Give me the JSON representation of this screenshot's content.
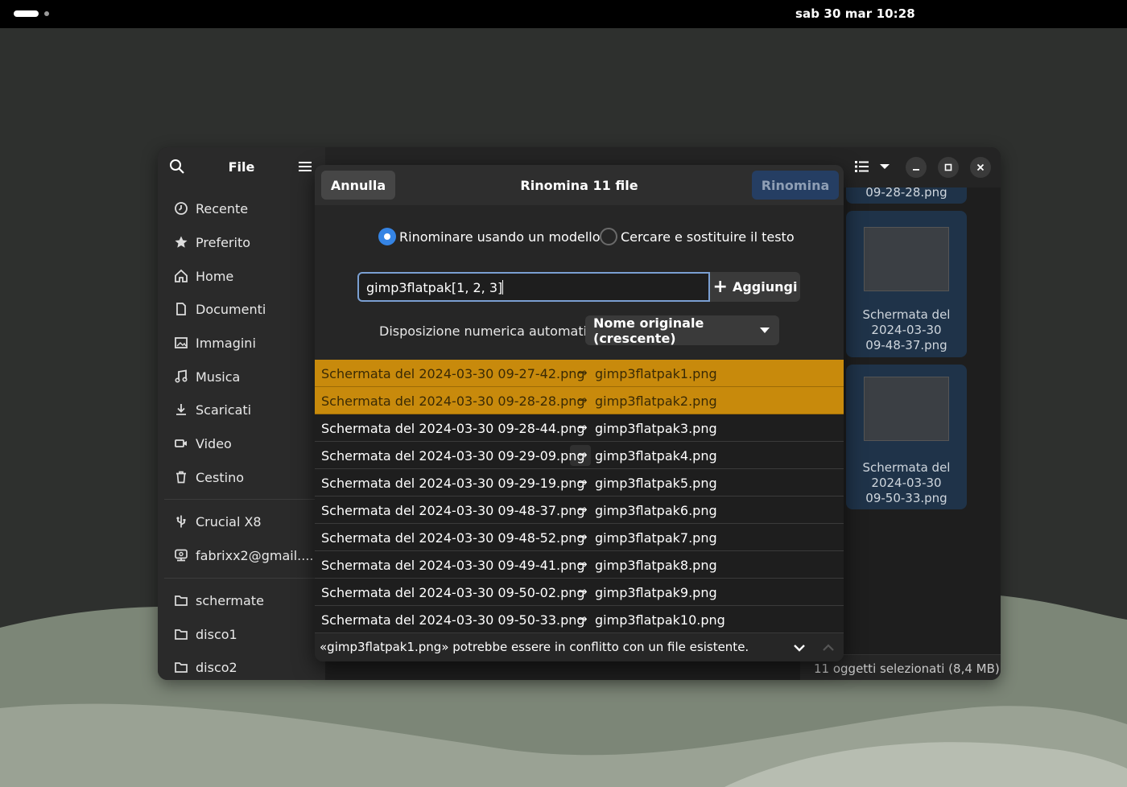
{
  "topbar": {
    "clock": "sab 30 mar  10:28"
  },
  "sidebar": {
    "title": "File",
    "places": [
      {
        "label": "Recente",
        "icon": "clock-icon"
      },
      {
        "label": "Preferito",
        "icon": "star-icon"
      },
      {
        "label": "Home",
        "icon": "home-icon"
      },
      {
        "label": "Documenti",
        "icon": "document-icon"
      },
      {
        "label": "Immagini",
        "icon": "image-icon"
      },
      {
        "label": "Musica",
        "icon": "music-icon"
      },
      {
        "label": "Scaricati",
        "icon": "download-icon"
      },
      {
        "label": "Video",
        "icon": "video-icon"
      },
      {
        "label": "Cestino",
        "icon": "trash-icon"
      }
    ],
    "devices": [
      {
        "label": "Crucial X8",
        "icon": "usb-icon"
      },
      {
        "label": "fabrixx2@gmail....",
        "icon": "network-icon"
      }
    ],
    "bookmarks": [
      {
        "label": "schermate",
        "icon": "folder-icon"
      },
      {
        "label": "disco1",
        "icon": "folder-icon"
      },
      {
        "label": "disco2",
        "icon": "folder-icon"
      }
    ]
  },
  "content": {
    "tiles": [
      {
        "caption": [
          "09-28-28.png"
        ]
      },
      {
        "caption": [
          "Schermata del",
          "2024-03-30",
          "09-48-37.png"
        ]
      },
      {
        "caption": [
          "Schermata del",
          "2024-03-30",
          "09-50-33.png"
        ]
      }
    ],
    "status": "11 oggetti selezionati  (8,4 MB)"
  },
  "dialog": {
    "cancel_label": "Annulla",
    "title": "Rinomina 11 file",
    "rename_label": "Rinomina",
    "mode_template_label": "Rinominare usando un modello",
    "mode_replace_label": "Cercare e sostituire il testo",
    "pattern_value": "gimp3flatpak[1, 2, 3]",
    "add_label": "Aggiungi",
    "order_label": "Disposizione numerica automatica",
    "order_value": "Nome originale (crescente)",
    "arrow_glyph": "→",
    "rows": [
      {
        "old": "Schermata del 2024-03-30 09-27-42.png",
        "new": "gimp3flatpak1.png",
        "conflict": true
      },
      {
        "old": "Schermata del 2024-03-30 09-28-28.png",
        "new": "gimp3flatpak2.png",
        "conflict": true
      },
      {
        "old": "Schermata del 2024-03-30 09-28-44.png",
        "new": "gimp3flatpak3.png",
        "conflict": false
      },
      {
        "old": "Schermata del 2024-03-30 09-29-09.png",
        "new": "gimp3flatpak4.png",
        "conflict": false,
        "focus": true
      },
      {
        "old": "Schermata del 2024-03-30 09-29-19.png",
        "new": "gimp3flatpak5.png",
        "conflict": false
      },
      {
        "old": "Schermata del 2024-03-30 09-48-37.png",
        "new": "gimp3flatpak6.png",
        "conflict": false
      },
      {
        "old": "Schermata del 2024-03-30 09-48-52.png",
        "new": "gimp3flatpak7.png",
        "conflict": false
      },
      {
        "old": "Schermata del 2024-03-30 09-49-41.png",
        "new": "gimp3flatpak8.png",
        "conflict": false
      },
      {
        "old": "Schermata del 2024-03-30 09-50-02.png",
        "new": "gimp3flatpak9.png",
        "conflict": false
      },
      {
        "old": "Schermata del 2024-03-30 09-50-33.png",
        "new": "gimp3flatpak10.png",
        "conflict": false
      }
    ],
    "warning": "«gimp3flatpak1.png» potrebbe essere in conflitto con un file esistente."
  },
  "colors": {
    "accent": "#3584e4",
    "conflict": "#c88a0c",
    "suggested": "#253e63"
  }
}
